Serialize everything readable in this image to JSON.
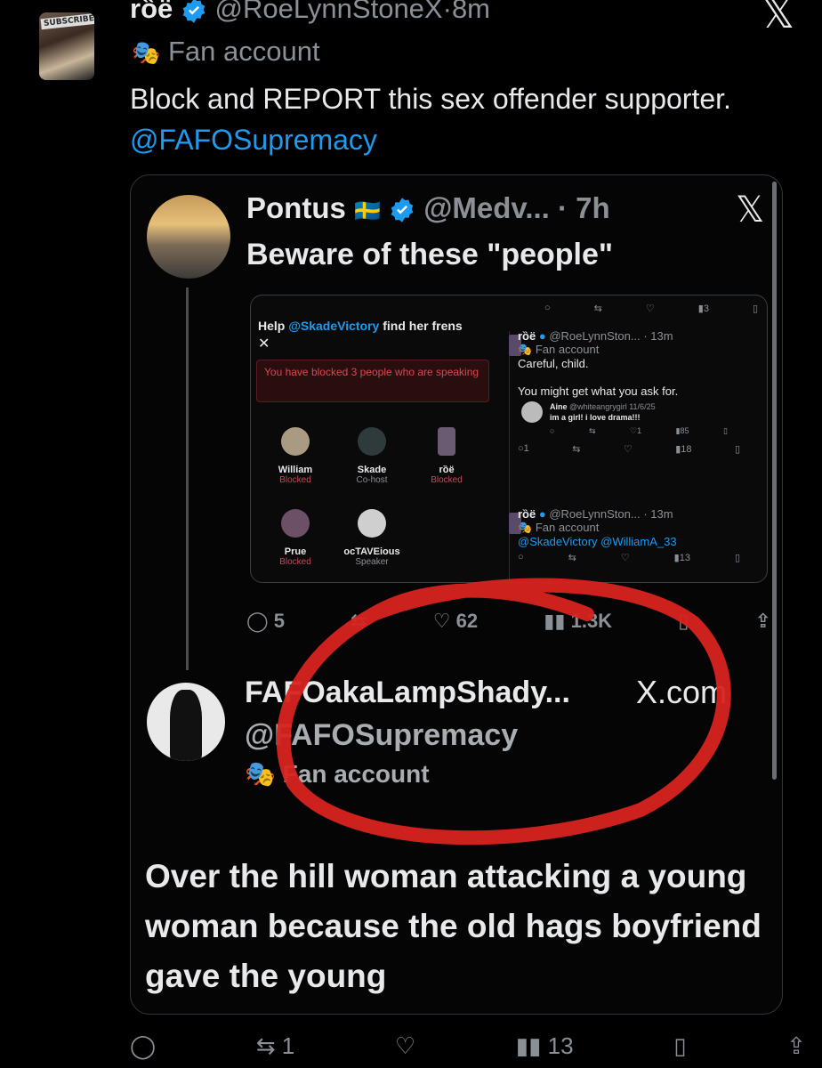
{
  "outer_tweet": {
    "display_name": "rȍë",
    "handle": "@RoeLynnStoneX",
    "time": "8m",
    "fan_label": "Fan account",
    "text": "Block and REPORT this sex offender supporter.",
    "mention": "@FAFOSupremacy",
    "avatar_sticker": "SUBSCRIBE",
    "actions": {
      "reply": "",
      "retweets": "1",
      "likes": "",
      "views": "13"
    },
    "close_icon": "x-logo-icon"
  },
  "quoted": {
    "display_name": "Pontus",
    "flag": "🇸🇪",
    "handle": "@Medv...",
    "time": "7h",
    "text": "Beware of these \"people\"",
    "actions": {
      "replies": "5",
      "retweets": "",
      "likes": "62",
      "views": "1.3K"
    },
    "space": {
      "title_prefix": "Help ",
      "title_mention": "@SkadeVictory",
      "title_suffix": " find her frens",
      "blocked_banner": "You have blocked 3 people who are speaking",
      "people": [
        {
          "name": "William",
          "role": "Blocked"
        },
        {
          "name": "Skade",
          "role": "Co-host"
        },
        {
          "name": "rȍë",
          "role": "Blocked"
        },
        {
          "name": "Prue",
          "role": "Blocked"
        },
        {
          "name": "ocTAVEious",
          "role": "Speaker"
        }
      ]
    },
    "replies": {
      "top_views": "3",
      "reply1": {
        "name": "rȍë",
        "handle": "@RoeLynnSton...",
        "time": "13m",
        "fan": "Fan account",
        "line1": "Careful, child.",
        "line2": "You might get what you ask for.",
        "embedded": {
          "name": "Aine",
          "handle": "@whiteangrygirl",
          "date": "11/6/25",
          "text": "im a girl! i love drama!!!",
          "likes": "1",
          "views": "85"
        },
        "reply_count": "1",
        "views": "18"
      },
      "reply2": {
        "name": "rȍë",
        "handle": "@RoeLynnSton...",
        "time": "13m",
        "fan": "Fan account",
        "line1": "@SkadeVictory @WilliamA_33",
        "views": "13"
      }
    },
    "profile_card": {
      "name": "FAFOakaLampShady...",
      "site": "X.com",
      "handle": "@FAFOSupremacy",
      "fan": "Fan account",
      "bio": "Over the hill woman attacking a young woman because the old hags boyfriend gave the young"
    }
  },
  "colors": {
    "accent": "#1d9bf0",
    "background": "#000000",
    "annotation_red": "#d8231f",
    "muted": "#8b9096"
  }
}
